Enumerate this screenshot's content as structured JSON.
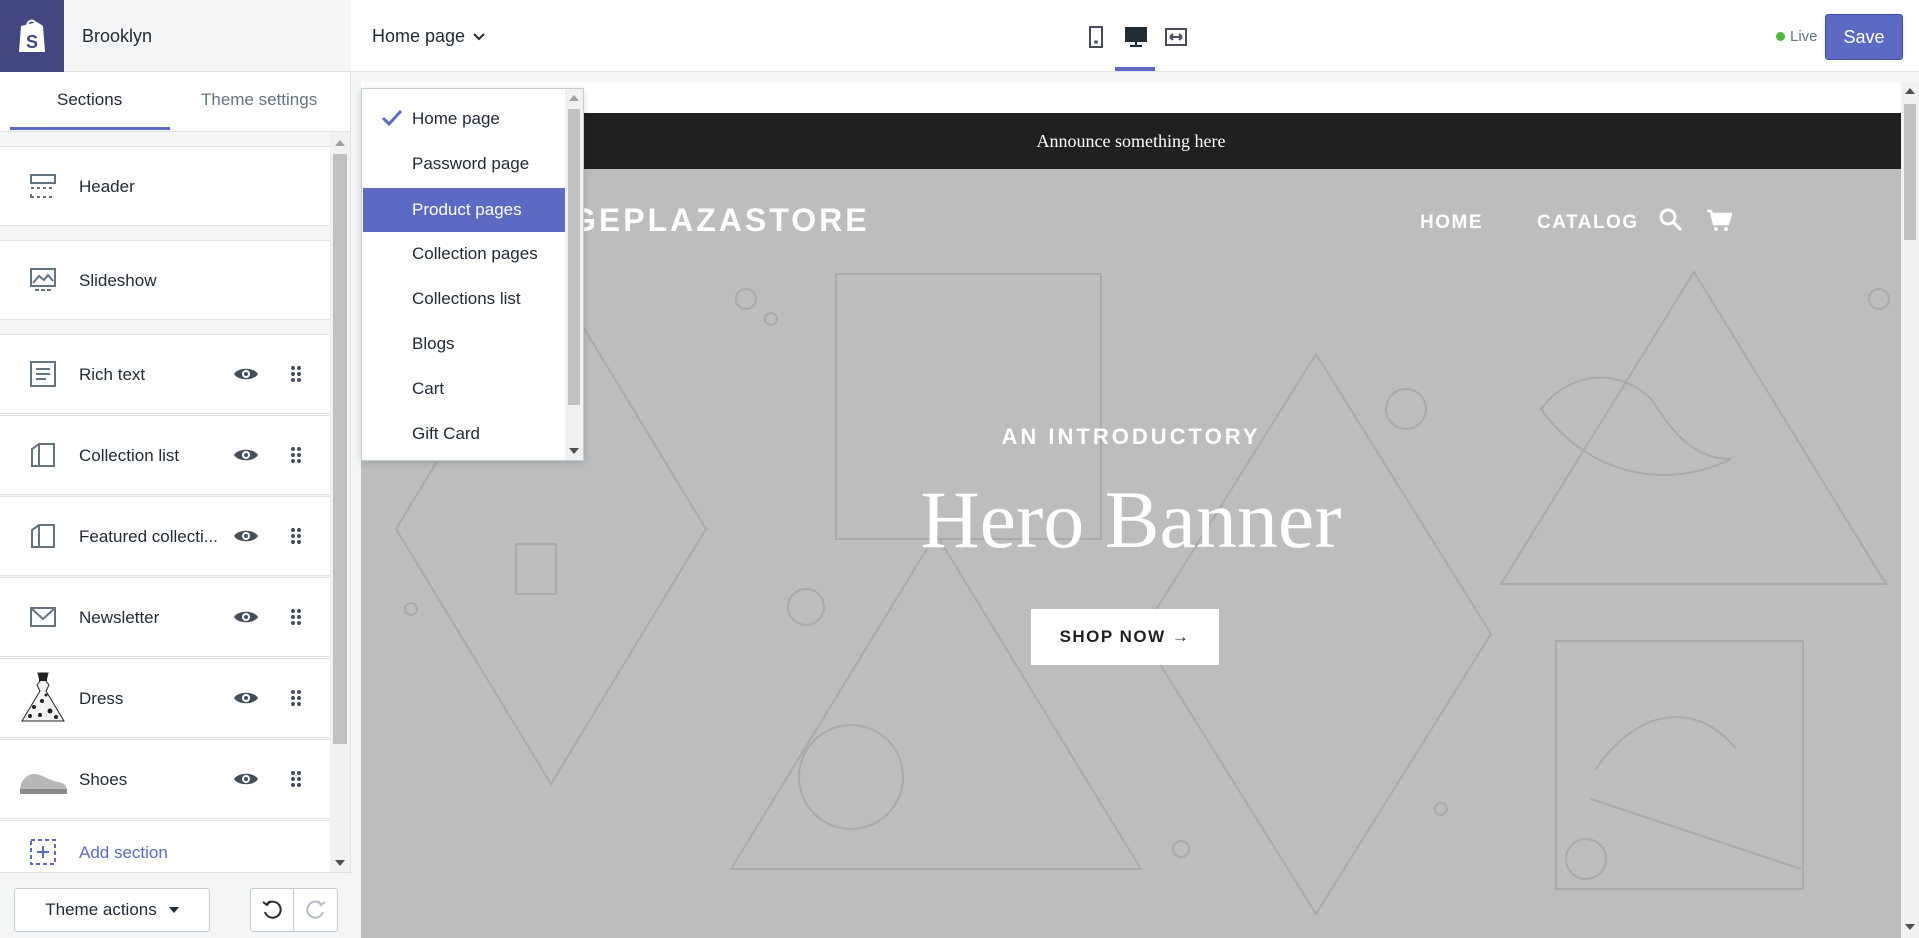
{
  "brand": {
    "store_name": "Brooklyn"
  },
  "tabs": [
    {
      "label": "Sections",
      "active": true
    },
    {
      "label": "Theme settings",
      "active": false
    }
  ],
  "sections": [
    {
      "label": "Header",
      "icon": "header-layout-icon"
    },
    {
      "label": "Slideshow",
      "icon": "slideshow-image-icon"
    },
    {
      "label": "Rich text",
      "icon": "text-block-icon"
    },
    {
      "label": "Collection list",
      "icon": "collection-icon"
    },
    {
      "label": "Featured collecti...",
      "icon": "collection-icon"
    },
    {
      "label": "Newsletter",
      "icon": "envelope-icon"
    },
    {
      "label": "Dress",
      "icon": "dress-thumbnail"
    },
    {
      "label": "Shoes",
      "icon": "shoes-thumbnail"
    }
  ],
  "add_section_label": "Add section",
  "footer": {
    "theme_actions_label": "Theme actions"
  },
  "topbar": {
    "page_select_label": "Home page",
    "status_label": "Live",
    "save_label": "Save",
    "devices": [
      "mobile-icon",
      "desktop-icon",
      "fullwidth-icon"
    ],
    "active_device": "desktop-icon"
  },
  "dropdown": {
    "items": [
      "Home page",
      "Password page",
      "Product pages",
      "Collection pages",
      "Collections list",
      "Blogs",
      "Cart",
      "Gift Card"
    ],
    "checked": "Home page",
    "highlighted": "Product pages"
  },
  "preview": {
    "announcement": "Announce something here",
    "logo_text": "GEPLAZASTORE",
    "nav": [
      "HOME",
      "CATALOG"
    ],
    "hero_subtitle": "AN INTRODUCTORY",
    "hero_title": "Hero Banner",
    "cta_label": "SHOP NOW →"
  },
  "colors": {
    "accent": "#5c6ac4",
    "brand_dark": "#43467f",
    "live_green": "#50b83c",
    "announcement_bg": "#1f2021",
    "hero_bg": "#bcbdbe"
  }
}
